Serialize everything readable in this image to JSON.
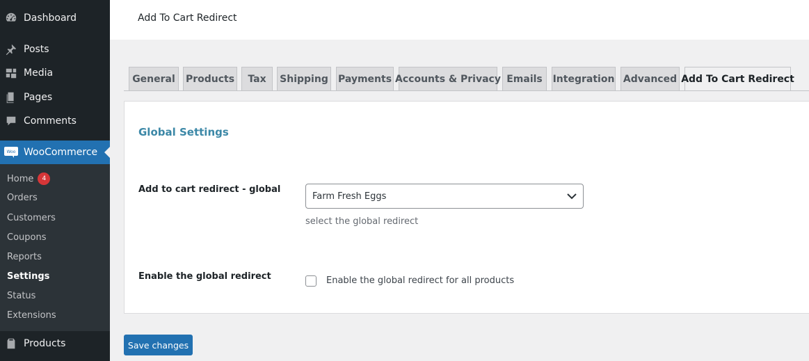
{
  "sidebar": {
    "menu": [
      {
        "label": "Dashboard",
        "icon": "dashboard-icon"
      },
      {
        "label": "Posts",
        "icon": "pin-icon"
      },
      {
        "label": "Media",
        "icon": "media-icon"
      },
      {
        "label": "Pages",
        "icon": "pages-icon"
      },
      {
        "label": "Comments",
        "icon": "comments-icon"
      },
      {
        "label": "WooCommerce",
        "icon": "woo-icon",
        "logo_text": "Woo"
      },
      {
        "label": "Products",
        "icon": "products-icon"
      }
    ],
    "submenu": [
      {
        "label": "Home",
        "badge": "4"
      },
      {
        "label": "Orders"
      },
      {
        "label": "Customers"
      },
      {
        "label": "Coupons"
      },
      {
        "label": "Reports"
      },
      {
        "label": "Settings"
      },
      {
        "label": "Status"
      },
      {
        "label": "Extensions"
      }
    ]
  },
  "header": {
    "title": "Add To Cart Redirect"
  },
  "tabs": [
    {
      "label": "General"
    },
    {
      "label": "Products"
    },
    {
      "label": "Tax"
    },
    {
      "label": "Shipping"
    },
    {
      "label": "Payments"
    },
    {
      "label": "Accounts & Privacy"
    },
    {
      "label": "Emails"
    },
    {
      "label": "Integration"
    },
    {
      "label": "Advanced"
    },
    {
      "label": "Add To Cart Redirect"
    }
  ],
  "settings": {
    "section_title": "Global Settings",
    "redirect_label": "Add to cart redirect - global",
    "redirect_value": "Farm Fresh Eggs",
    "redirect_help": "select the global redirect",
    "enable_label": "Enable the global redirect",
    "enable_checkbox_label": "Enable the global redirect for all products",
    "enable_checked": false
  },
  "actions": {
    "save_label": "Save changes"
  },
  "colors": {
    "sidebar_bg": "#1d2327",
    "submenu_bg": "#2c3338",
    "accent": "#2271b1",
    "badge": "#d63638",
    "section_title": "#3c88a7"
  }
}
